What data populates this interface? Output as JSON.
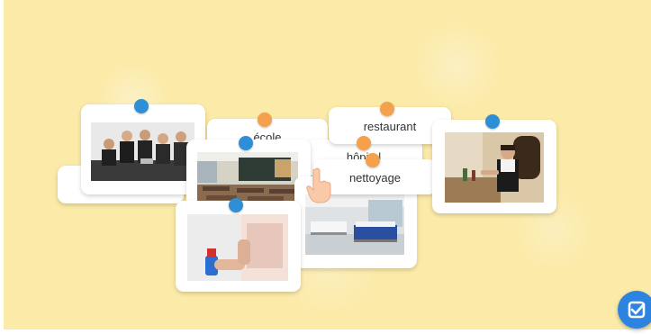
{
  "words": {
    "ecole": "école",
    "restaurant": "restaurant",
    "hopital": "hôpital",
    "nettoyage": "nettoyage"
  },
  "colors": {
    "background": "#fbeaa8",
    "pin_blue": "#2e8fd6",
    "pin_orange": "#f4a04c",
    "check_button": "#2c84e0"
  },
  "icons": {
    "check": "check-square-icon",
    "hand": "hand-pointer-icon"
  },
  "images": [
    "business-meeting-photo",
    "classroom-photo",
    "cleaning-spray-photo",
    "hospital-ward-photo",
    "waitress-photo"
  ]
}
